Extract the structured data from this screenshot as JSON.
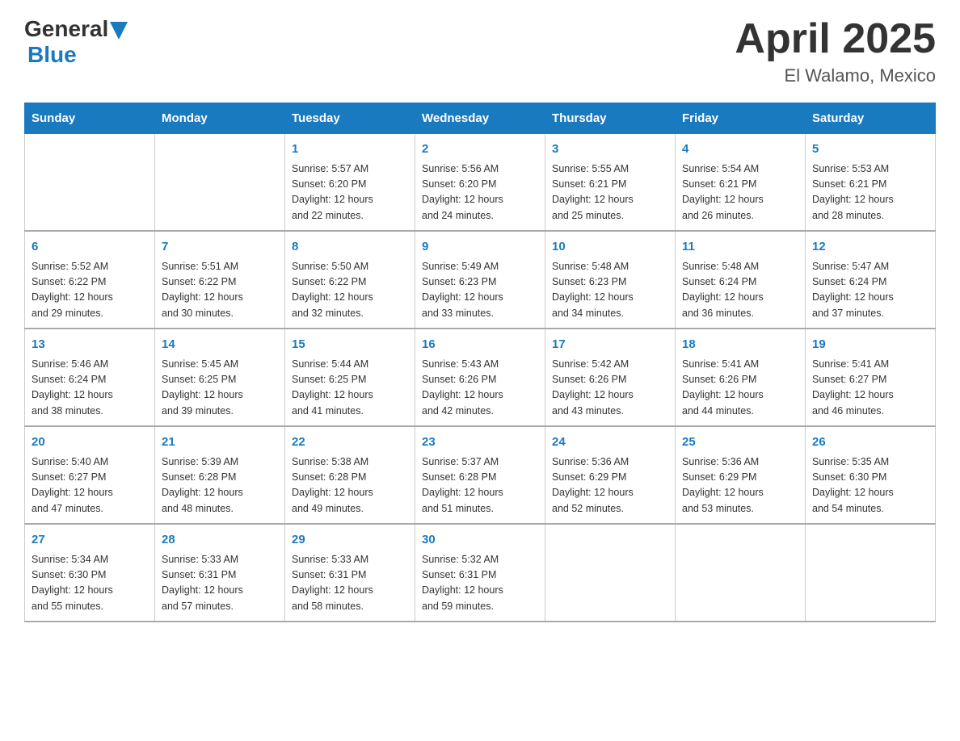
{
  "header": {
    "logo_general": "General",
    "logo_blue": "Blue",
    "title": "April 2025",
    "subtitle": "El Walamo, Mexico"
  },
  "days_of_week": [
    "Sunday",
    "Monday",
    "Tuesday",
    "Wednesday",
    "Thursday",
    "Friday",
    "Saturday"
  ],
  "weeks": [
    [
      {
        "day": "",
        "info": ""
      },
      {
        "day": "",
        "info": ""
      },
      {
        "day": "1",
        "info": "Sunrise: 5:57 AM\nSunset: 6:20 PM\nDaylight: 12 hours\nand 22 minutes."
      },
      {
        "day": "2",
        "info": "Sunrise: 5:56 AM\nSunset: 6:20 PM\nDaylight: 12 hours\nand 24 minutes."
      },
      {
        "day": "3",
        "info": "Sunrise: 5:55 AM\nSunset: 6:21 PM\nDaylight: 12 hours\nand 25 minutes."
      },
      {
        "day": "4",
        "info": "Sunrise: 5:54 AM\nSunset: 6:21 PM\nDaylight: 12 hours\nand 26 minutes."
      },
      {
        "day": "5",
        "info": "Sunrise: 5:53 AM\nSunset: 6:21 PM\nDaylight: 12 hours\nand 28 minutes."
      }
    ],
    [
      {
        "day": "6",
        "info": "Sunrise: 5:52 AM\nSunset: 6:22 PM\nDaylight: 12 hours\nand 29 minutes."
      },
      {
        "day": "7",
        "info": "Sunrise: 5:51 AM\nSunset: 6:22 PM\nDaylight: 12 hours\nand 30 minutes."
      },
      {
        "day": "8",
        "info": "Sunrise: 5:50 AM\nSunset: 6:22 PM\nDaylight: 12 hours\nand 32 minutes."
      },
      {
        "day": "9",
        "info": "Sunrise: 5:49 AM\nSunset: 6:23 PM\nDaylight: 12 hours\nand 33 minutes."
      },
      {
        "day": "10",
        "info": "Sunrise: 5:48 AM\nSunset: 6:23 PM\nDaylight: 12 hours\nand 34 minutes."
      },
      {
        "day": "11",
        "info": "Sunrise: 5:48 AM\nSunset: 6:24 PM\nDaylight: 12 hours\nand 36 minutes."
      },
      {
        "day": "12",
        "info": "Sunrise: 5:47 AM\nSunset: 6:24 PM\nDaylight: 12 hours\nand 37 minutes."
      }
    ],
    [
      {
        "day": "13",
        "info": "Sunrise: 5:46 AM\nSunset: 6:24 PM\nDaylight: 12 hours\nand 38 minutes."
      },
      {
        "day": "14",
        "info": "Sunrise: 5:45 AM\nSunset: 6:25 PM\nDaylight: 12 hours\nand 39 minutes."
      },
      {
        "day": "15",
        "info": "Sunrise: 5:44 AM\nSunset: 6:25 PM\nDaylight: 12 hours\nand 41 minutes."
      },
      {
        "day": "16",
        "info": "Sunrise: 5:43 AM\nSunset: 6:26 PM\nDaylight: 12 hours\nand 42 minutes."
      },
      {
        "day": "17",
        "info": "Sunrise: 5:42 AM\nSunset: 6:26 PM\nDaylight: 12 hours\nand 43 minutes."
      },
      {
        "day": "18",
        "info": "Sunrise: 5:41 AM\nSunset: 6:26 PM\nDaylight: 12 hours\nand 44 minutes."
      },
      {
        "day": "19",
        "info": "Sunrise: 5:41 AM\nSunset: 6:27 PM\nDaylight: 12 hours\nand 46 minutes."
      }
    ],
    [
      {
        "day": "20",
        "info": "Sunrise: 5:40 AM\nSunset: 6:27 PM\nDaylight: 12 hours\nand 47 minutes."
      },
      {
        "day": "21",
        "info": "Sunrise: 5:39 AM\nSunset: 6:28 PM\nDaylight: 12 hours\nand 48 minutes."
      },
      {
        "day": "22",
        "info": "Sunrise: 5:38 AM\nSunset: 6:28 PM\nDaylight: 12 hours\nand 49 minutes."
      },
      {
        "day": "23",
        "info": "Sunrise: 5:37 AM\nSunset: 6:28 PM\nDaylight: 12 hours\nand 51 minutes."
      },
      {
        "day": "24",
        "info": "Sunrise: 5:36 AM\nSunset: 6:29 PM\nDaylight: 12 hours\nand 52 minutes."
      },
      {
        "day": "25",
        "info": "Sunrise: 5:36 AM\nSunset: 6:29 PM\nDaylight: 12 hours\nand 53 minutes."
      },
      {
        "day": "26",
        "info": "Sunrise: 5:35 AM\nSunset: 6:30 PM\nDaylight: 12 hours\nand 54 minutes."
      }
    ],
    [
      {
        "day": "27",
        "info": "Sunrise: 5:34 AM\nSunset: 6:30 PM\nDaylight: 12 hours\nand 55 minutes."
      },
      {
        "day": "28",
        "info": "Sunrise: 5:33 AM\nSunset: 6:31 PM\nDaylight: 12 hours\nand 57 minutes."
      },
      {
        "day": "29",
        "info": "Sunrise: 5:33 AM\nSunset: 6:31 PM\nDaylight: 12 hours\nand 58 minutes."
      },
      {
        "day": "30",
        "info": "Sunrise: 5:32 AM\nSunset: 6:31 PM\nDaylight: 12 hours\nand 59 minutes."
      },
      {
        "day": "",
        "info": ""
      },
      {
        "day": "",
        "info": ""
      },
      {
        "day": "",
        "info": ""
      }
    ]
  ]
}
